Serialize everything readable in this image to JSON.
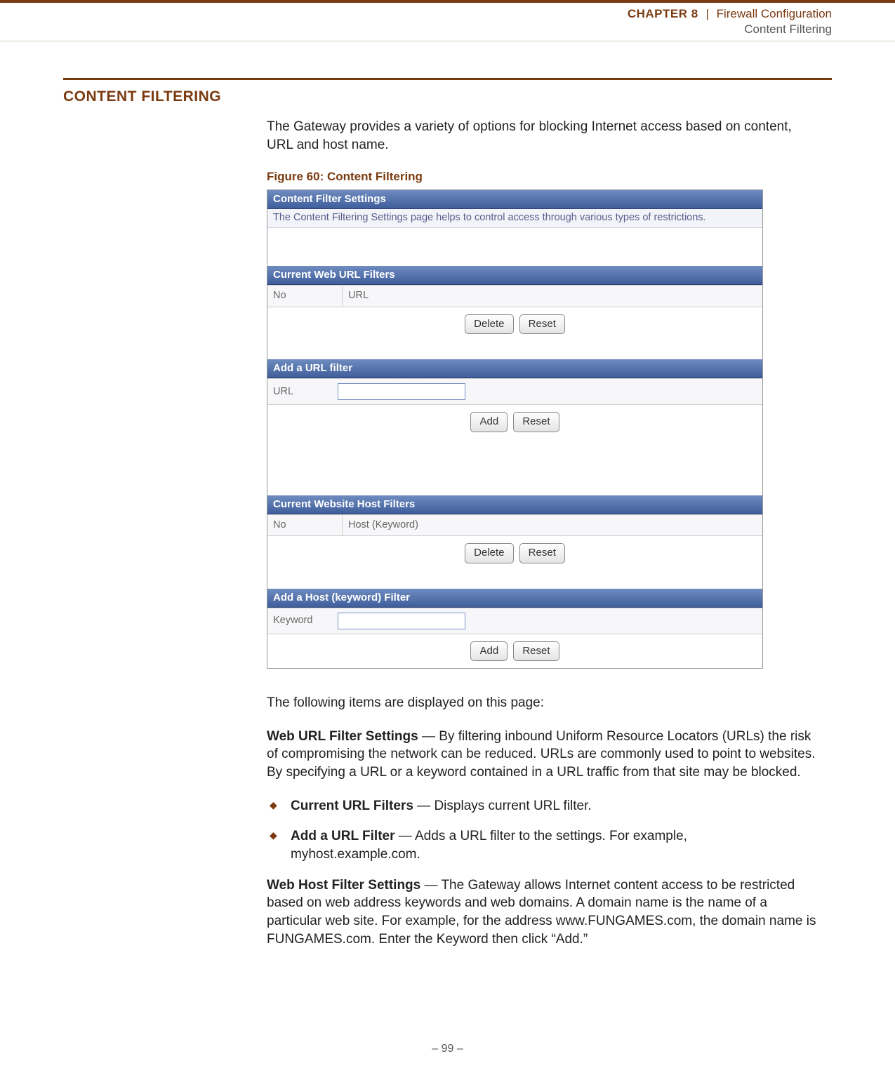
{
  "header": {
    "chapter_label": "CHAPTER 8",
    "separator": "|",
    "breadcrumb": "Firewall Configuration",
    "subtitle": "Content Filtering"
  },
  "section": {
    "title": "CONTENT FILTERING",
    "intro": "The Gateway provides a variety of options for blocking Internet access based on content, URL and host name."
  },
  "figure": {
    "caption": "Figure 60:  Content Filtering",
    "panel1_title": "Content Filter Settings",
    "panel1_desc": "The Content Filtering Settings page helps to control access through various types of restrictions.",
    "panel2_title": "Current Web URL Filters",
    "col_no": "No",
    "col_url": "URL",
    "btn_delete": "Delete",
    "btn_reset": "Reset",
    "panel3_title": "Add a URL filter",
    "label_url": "URL",
    "btn_add": "Add",
    "panel4_title": "Current Website Host Filters",
    "col_host": "Host (Keyword)",
    "panel5_title": "Add a Host (keyword) Filter",
    "label_keyword": "Keyword"
  },
  "post": {
    "lead": "The following items are displayed on this page:",
    "s1_bold": "Web URL Filter Settings",
    "s1_rest": " — By filtering inbound Uniform Resource Locators (URLs) the risk of compromising the network can be reduced. URLs are commonly used to point to websites. By specifying a URL or a keyword contained in a URL traffic from that site may be blocked.",
    "b1_bold": "Current URL Filters",
    "b1_rest": " — Displays current URL filter.",
    "b2_bold": "Add a URL Filter",
    "b2_rest": " — Adds a URL filter to the settings. For example, myhost.example.com.",
    "s2_bold": "Web Host Filter Settings",
    "s2_rest": " — The Gateway allows Internet content access to be restricted based on web address keywords and web domains. A domain name is the name of a particular web site. For example, for the address www.FUNGAMES.com, the domain name is FUNGAMES.com. Enter the Keyword then click “Add.”"
  },
  "footer": {
    "page": "–  99  –"
  }
}
